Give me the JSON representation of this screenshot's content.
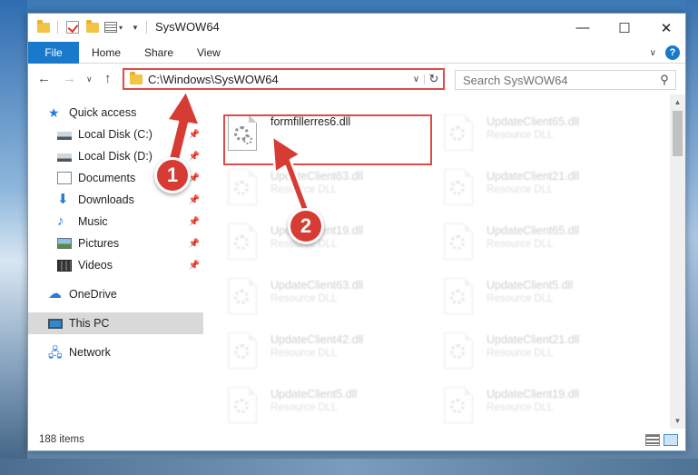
{
  "window": {
    "title": "SysWOW64",
    "minimize": "—",
    "maximize": "☐",
    "close": "✕"
  },
  "ribbon": {
    "tabs": [
      "File",
      "Home",
      "Share",
      "View"
    ]
  },
  "address": {
    "path": "C:\\Windows\\SysWOW64",
    "search_placeholder": "Search SysWOW64"
  },
  "nav": {
    "items": [
      {
        "label": "Quick access",
        "icon": "star-icon"
      },
      {
        "label": "Local Disk (C:)",
        "icon": "drive-icon",
        "pinned": true
      },
      {
        "label": "Local Disk (D:)",
        "icon": "drive-icon",
        "pinned": true
      },
      {
        "label": "Documents",
        "icon": "documents-icon",
        "pinned": true
      },
      {
        "label": "Downloads",
        "icon": "download-icon",
        "pinned": true
      },
      {
        "label": "Music",
        "icon": "music-icon",
        "pinned": true
      },
      {
        "label": "Pictures",
        "icon": "pictures-icon",
        "pinned": true
      },
      {
        "label": "Videos",
        "icon": "videos-icon",
        "pinned": true
      },
      {
        "label": "OneDrive",
        "icon": "cloud-icon"
      },
      {
        "label": "This PC",
        "icon": "computer-icon",
        "selected": true
      },
      {
        "label": "Network",
        "icon": "network-icon"
      }
    ]
  },
  "files": [
    {
      "name": "formfillerres6.dll",
      "type": "",
      "faded": false
    },
    {
      "name": "UpdateClient65.dll",
      "type": "Resource DLL",
      "faded": true
    },
    {
      "name": "UpdateClient63.dll",
      "type": "Resource DLL",
      "faded": true
    },
    {
      "name": "UpdateClient21.dll",
      "type": "Resource DLL",
      "faded": true
    },
    {
      "name": "UpdateClient19.dll",
      "type": "Resource DLL",
      "faded": true
    },
    {
      "name": "UpdateClient65.dll",
      "type": "Resource DLL",
      "faded": true
    },
    {
      "name": "UpdateClient63.dll",
      "type": "Resource DLL",
      "faded": true
    },
    {
      "name": "UpdateClient5.dll",
      "type": "Resource DLL",
      "faded": true
    },
    {
      "name": "UpdateClient42.dll",
      "type": "Resource DLL",
      "faded": true
    },
    {
      "name": "UpdateClient21.dll",
      "type": "Resource DLL",
      "faded": true
    },
    {
      "name": "UpdateClient5.dll",
      "type": "Resource DLL",
      "faded": true
    },
    {
      "name": "UpdateClient19.dll",
      "type": "Resource DLL",
      "faded": true
    }
  ],
  "status": {
    "count": "188 items"
  },
  "annotations": {
    "step1": "1",
    "step2": "2",
    "color": "#d73c34"
  }
}
